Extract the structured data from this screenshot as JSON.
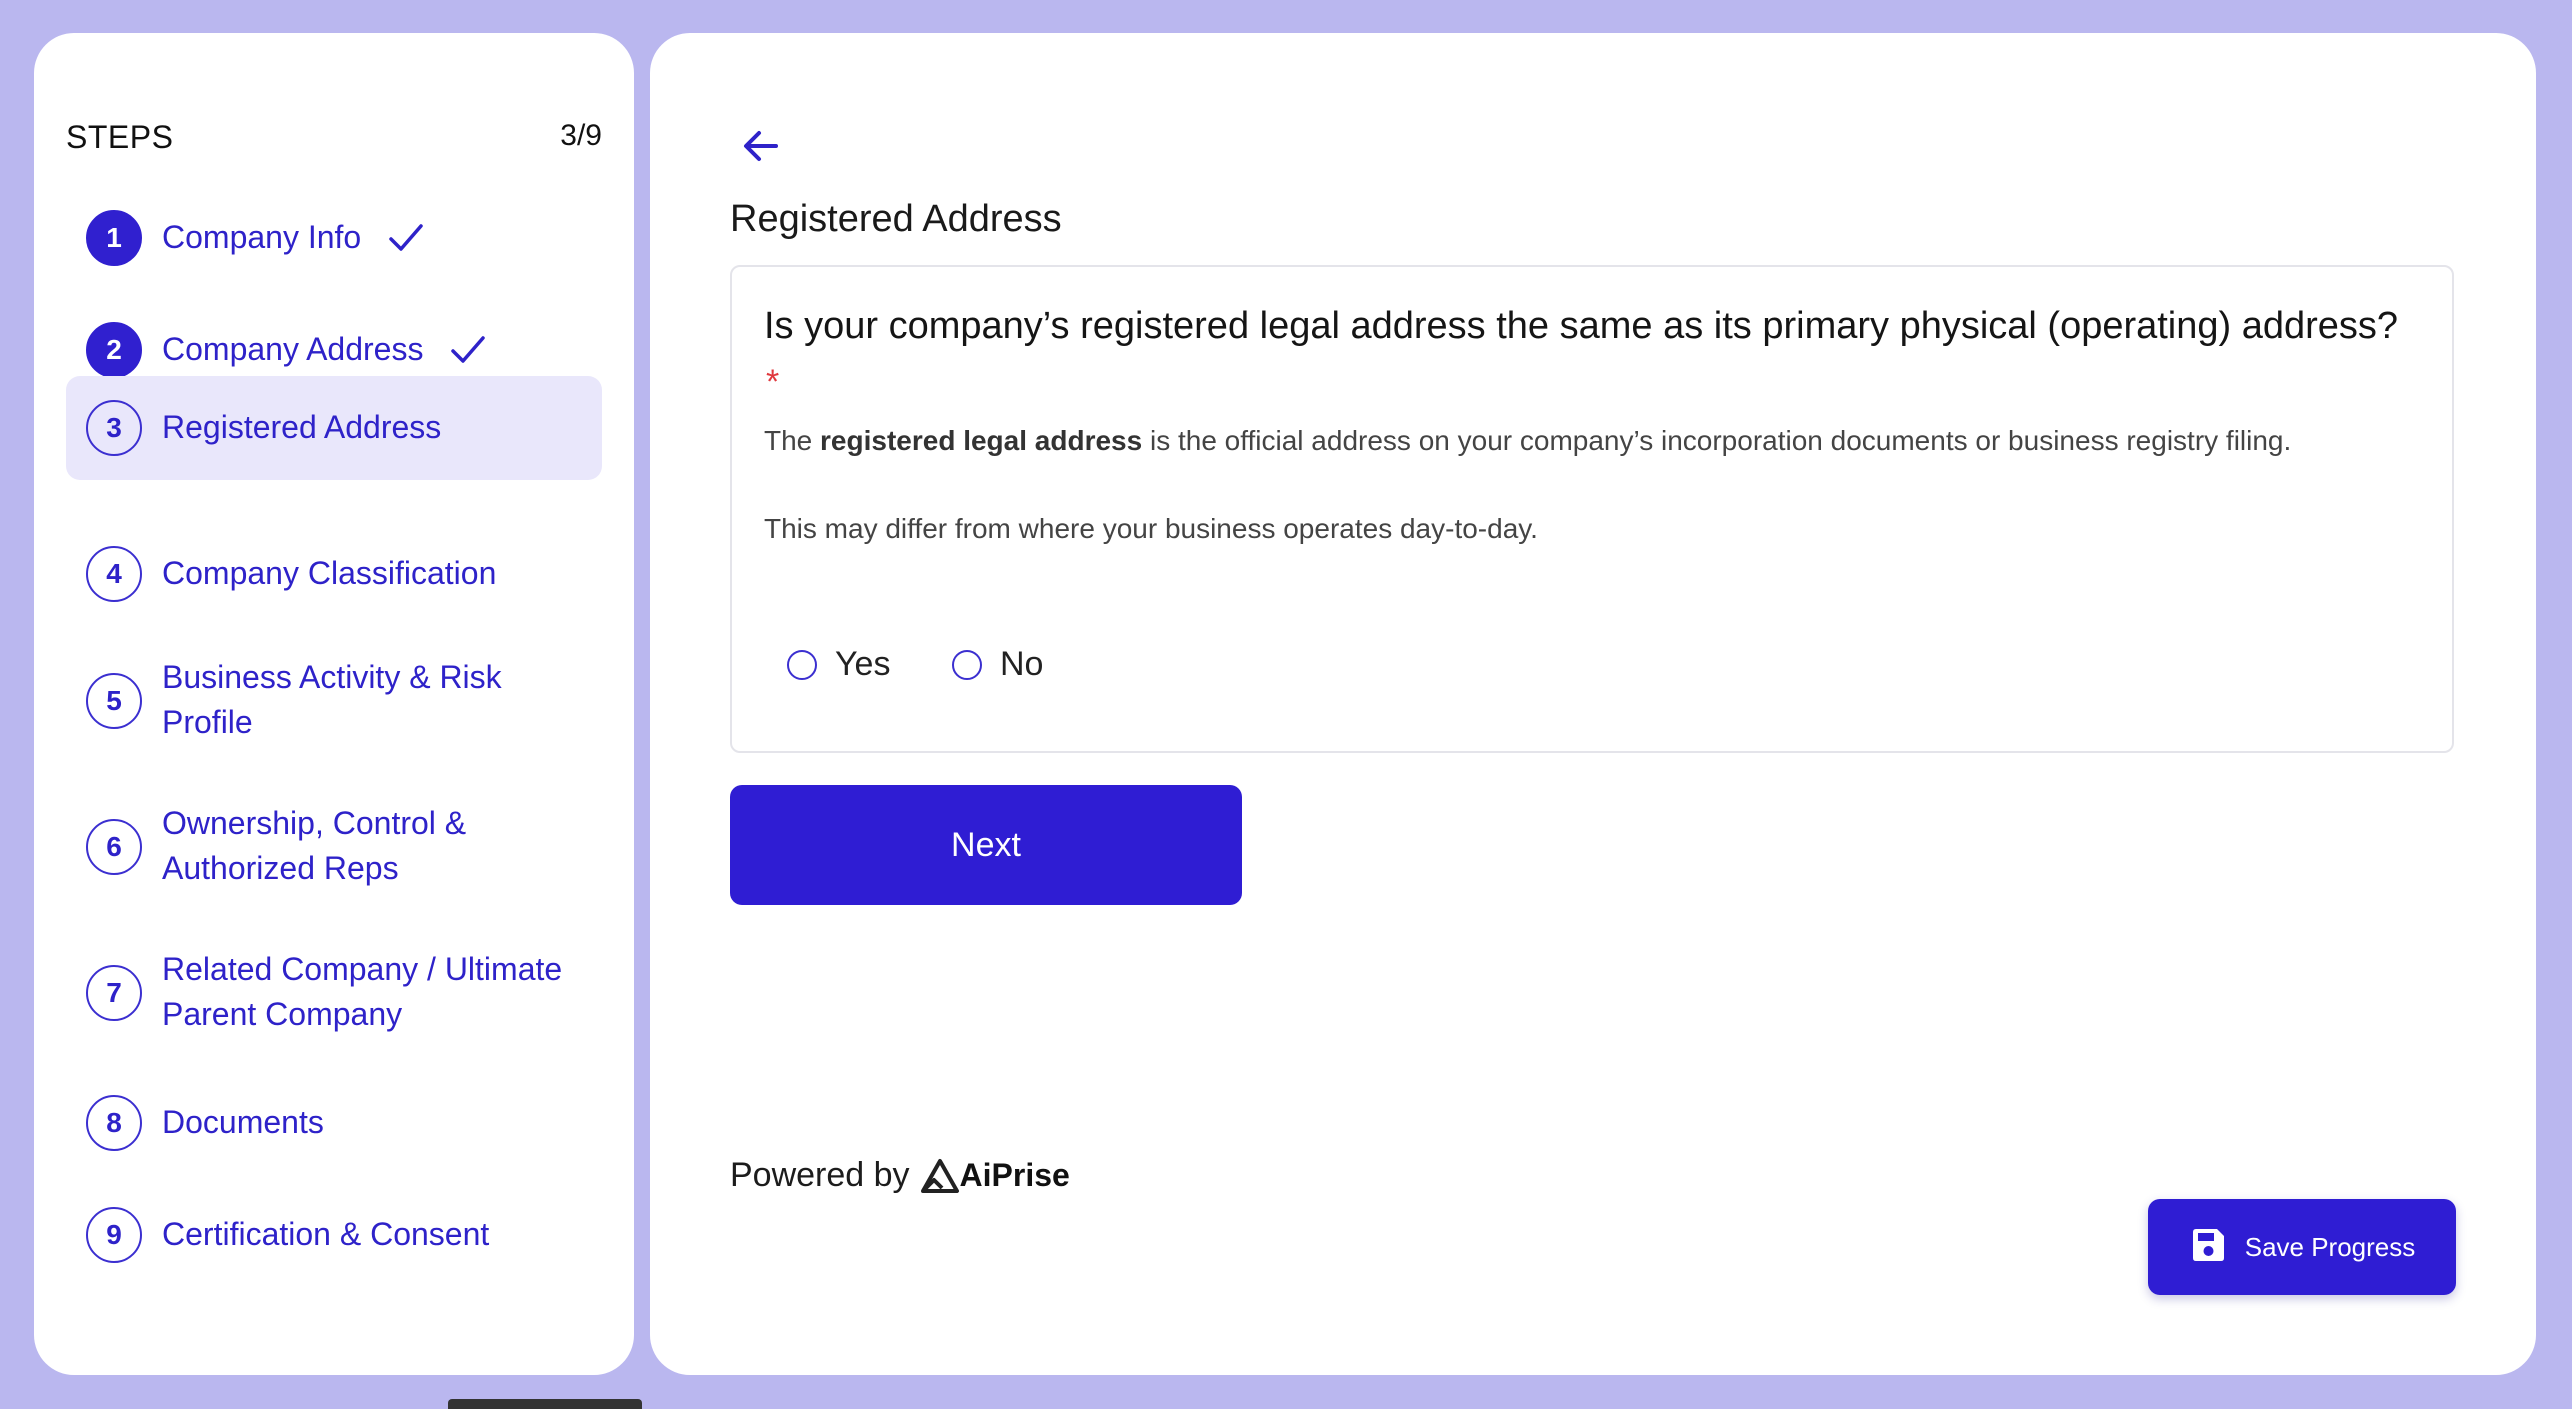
{
  "sidebar": {
    "title": "STEPS",
    "count": "3/9",
    "steps": [
      {
        "num": "1",
        "line1": "Company Info",
        "line2": "",
        "status": "done"
      },
      {
        "num": "2",
        "line1": "Company Address",
        "line2": "",
        "status": "done"
      },
      {
        "num": "3",
        "line1": "Registered Address",
        "line2": "",
        "status": "active"
      },
      {
        "num": "4",
        "line1": "Company Classification",
        "line2": "",
        "status": "pending"
      },
      {
        "num": "5",
        "line1": "Business Activity & Risk",
        "line2": "Profile",
        "status": "pending"
      },
      {
        "num": "6",
        "line1": "Ownership, Control &",
        "line2": "Authorized Reps",
        "status": "pending"
      },
      {
        "num": "7",
        "line1": "Related Company / Ultimate",
        "line2": "Parent Company",
        "status": "pending"
      },
      {
        "num": "8",
        "line1": "Documents",
        "line2": "",
        "status": "pending"
      },
      {
        "num": "9",
        "line1": "Certification & Consent",
        "line2": "",
        "status": "pending"
      }
    ]
  },
  "main": {
    "section_title": "Registered Address",
    "question": "Is your company’s registered legal address the same as its primary physical (operating) address?",
    "required_mark": "*",
    "desc1_prefix": "The ",
    "desc1_bold": "registered legal address",
    "desc1_suffix": " is the official address on your company’s incorporation documents or business registry filing.",
    "desc2": "This may differ from where your business operates day-to-day.",
    "options": [
      "Yes",
      "No"
    ],
    "next_label": "Next",
    "powered_by": "Powered by",
    "brand": "AiPrise",
    "save_label": "Save Progress"
  },
  "colors": {
    "background": "#bab7ef",
    "accent": "#2f1dd3",
    "active_step_bg": "#e9e7fb",
    "required": "#e0393e"
  }
}
